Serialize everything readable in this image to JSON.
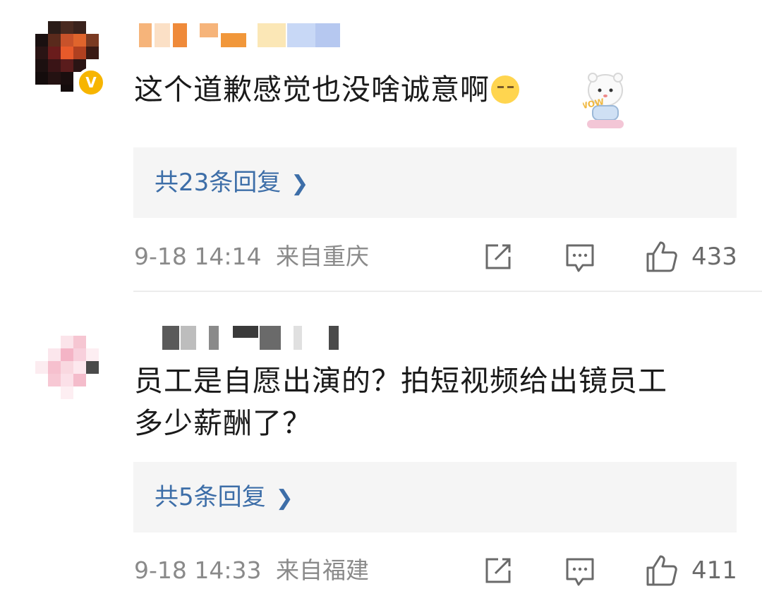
{
  "comments": [
    {
      "text": "这个道歉感觉也没啥诚意啊",
      "verified_badge": "V",
      "emoji_icon": "squint-face-emoji",
      "sticker": "wow-bear-sticker",
      "sticker_text": "WOW",
      "reply_label": "共23条回复",
      "timestamp": "9-18 14:14",
      "location": "来自重庆",
      "likes": "433"
    },
    {
      "text_line1": "员工是自愿出演的？拍短视频给出镜员工",
      "text_line2": "多少薪酬了？",
      "reply_label": "共5条回复",
      "timestamp": "9-18 14:33",
      "location": "来自福建",
      "likes": "411"
    }
  ],
  "icons": {
    "repost": "repost-icon",
    "comment": "comment-icon",
    "like": "like-icon",
    "chevron": "chevron-right-icon"
  },
  "colors": {
    "link": "#3d6ea8",
    "meta": "#8a8a8a",
    "reply_bg": "#f5f5f5",
    "badge": "#f7b500"
  }
}
